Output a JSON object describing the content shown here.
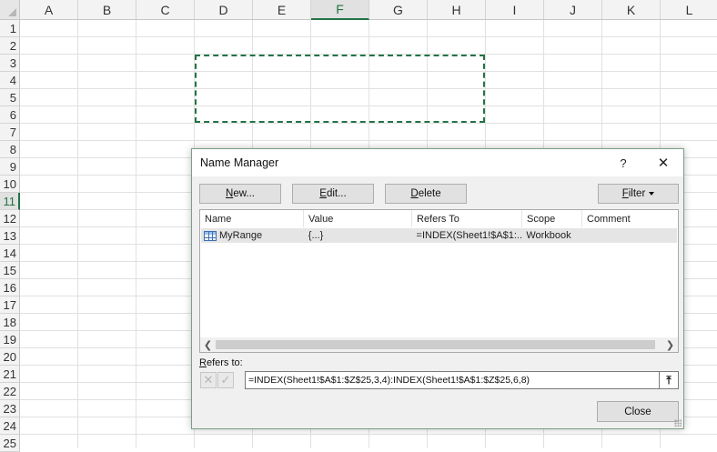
{
  "spreadsheet": {
    "columns": [
      "A",
      "B",
      "C",
      "D",
      "E",
      "F",
      "G",
      "H",
      "I",
      "J",
      "K",
      "L"
    ],
    "rows": [
      "1",
      "2",
      "3",
      "4",
      "5",
      "6",
      "7",
      "8",
      "9",
      "10",
      "11",
      "12",
      "13",
      "14",
      "15",
      "16",
      "17",
      "18",
      "19",
      "20",
      "21",
      "22",
      "23",
      "24",
      "25"
    ],
    "active_column": "F",
    "active_row": "11",
    "accent_color": "#217346"
  },
  "dialog": {
    "title": "Name Manager",
    "help_label": "?",
    "close_glyph": "✕",
    "buttons": {
      "new_pre": "",
      "new_key": "N",
      "new_post": "ew...",
      "edit_pre": "",
      "edit_key": "E",
      "edit_post": "dit...",
      "delete_pre": "",
      "delete_key": "D",
      "delete_post": "elete",
      "filter_pre": "",
      "filter_key": "F",
      "filter_post": "ilter"
    },
    "list": {
      "columns": {
        "name": "Name",
        "value": "Value",
        "refers_to": "Refers To",
        "scope": "Scope",
        "comment": "Comment"
      },
      "rows": [
        {
          "name": "MyRange",
          "value": "{...}",
          "refers_to": "=INDEX(Sheet1!$A$1:...",
          "scope": "Workbook",
          "comment": ""
        }
      ]
    },
    "refers_to_label_key": "R",
    "refers_to_label_rest": "efers to:",
    "refers_to_value": "=INDEX(Sheet1!$A$1:$Z$25,3,4):INDEX(Sheet1!$A$1:$Z$25,6,8)",
    "close_button": "Close"
  }
}
